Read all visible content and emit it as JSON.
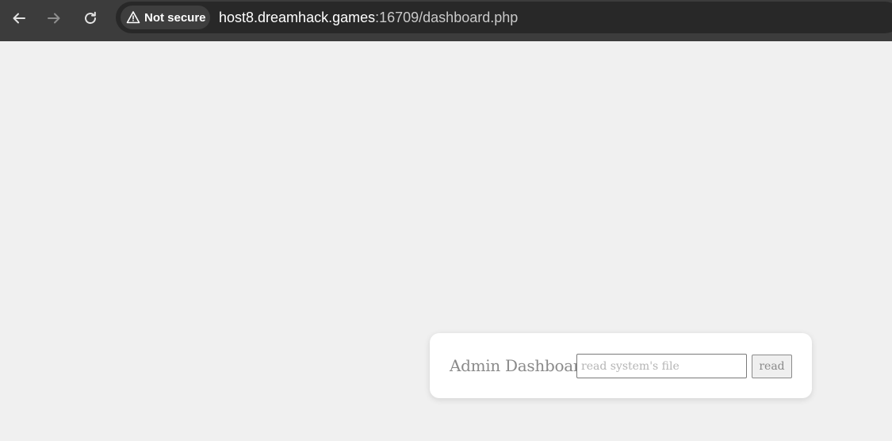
{
  "browser": {
    "security_label": "Not secure",
    "url_host": "host8.dreamhack.games",
    "url_rest": ":16709/dashboard.php",
    "icons": {
      "back": "back-arrow-icon",
      "forward": "forward-arrow-icon",
      "reload": "reload-icon",
      "warning": "warning-triangle-icon"
    }
  },
  "dashboard": {
    "title": "Admin Dashboard",
    "file_input": {
      "placeholder": "read system's file",
      "value": ""
    },
    "read_button_label": "read"
  },
  "colors": {
    "toolbar": "#3c3c3c",
    "omnibox": "#282828",
    "page_background": "#f0f0f0",
    "card_background": "#ffffff",
    "text_muted": "#8a8a8a"
  }
}
